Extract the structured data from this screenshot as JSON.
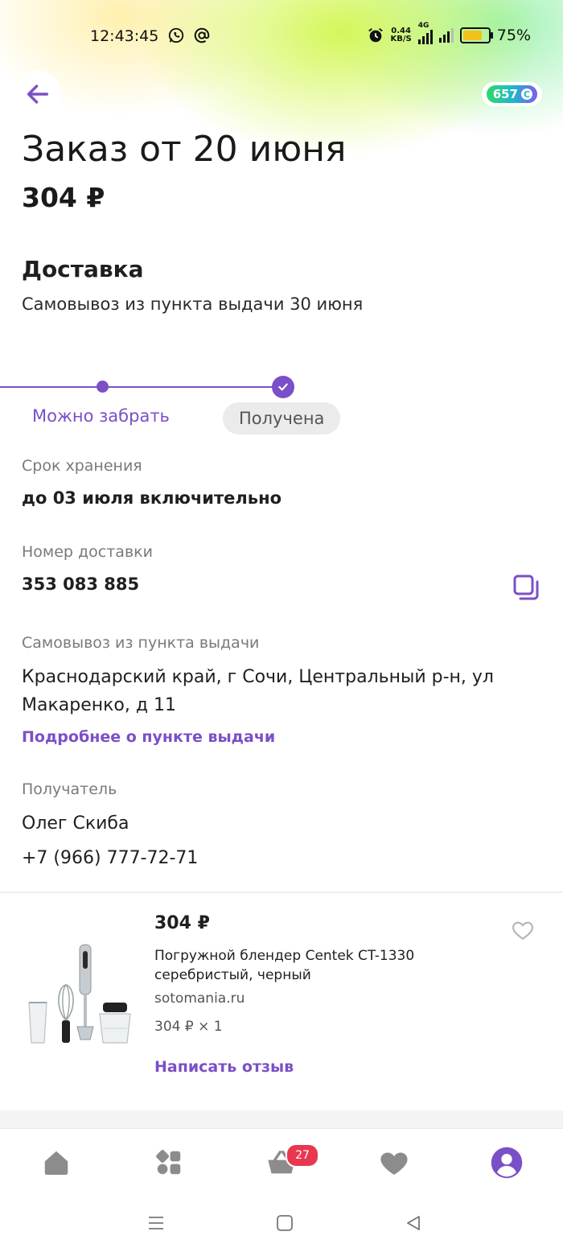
{
  "status_bar": {
    "time": "12:43:45",
    "speed_top": "0.44",
    "speed_bottom": "KB/S",
    "network": "4G",
    "battery_percent": "75%",
    "battery_level": 0.75
  },
  "header": {
    "points": "657",
    "points_coin_symbol": "С"
  },
  "order": {
    "title": "Заказ от 20 июня",
    "total": "304 ₽"
  },
  "delivery": {
    "title": "Доставка",
    "subtitle": "Самовывоз из пункта выдачи 30 июня"
  },
  "progress": {
    "step_ready": "Можно забрать",
    "step_received": "Получена"
  },
  "details": {
    "storage_label": "Срок хранения",
    "storage_value": "до 03 июля включительно",
    "tracking_label": "Номер доставки",
    "tracking_value": "353 083 885",
    "pickup_label": "Самовывоз из пункта выдачи",
    "pickup_address": "Краснодарский край, г Сочи, Центральный р-н, ул Макаренко, д 11",
    "pickup_link": "Подробнее о пункте выдачи",
    "recipient_label": "Получатель",
    "recipient_name": "Олег Скиба",
    "recipient_phone": "+7 (966) 777-72-71"
  },
  "product": {
    "price": "304 ₽",
    "name": "Погружной блендер Centek CT-1330 серебристый, черный",
    "seller": "sotomania.ru",
    "qty": "304 ₽ × 1",
    "review_link": "Написать отзыв"
  },
  "bottom_nav": {
    "cart_count": "27"
  },
  "colors": {
    "accent": "#7b4fc8",
    "badge": "#e8384f"
  }
}
